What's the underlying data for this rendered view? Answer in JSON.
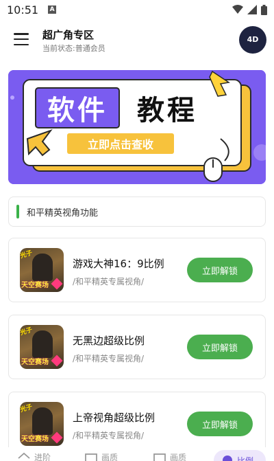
{
  "status": {
    "time": "10:51",
    "indicator": "A"
  },
  "header": {
    "title": "超广角专区",
    "subtitle": "当前状态:普通会员",
    "avatar_logo": "4D"
  },
  "banner": {
    "word1": "软件",
    "word2": "教程",
    "cta": "立即点击查收"
  },
  "section": {
    "title": "和平精英视角功能"
  },
  "items": [
    {
      "name": "游戏大神16：9比例",
      "subtitle": "/和平精英专属视角/",
      "button": "立即解锁",
      "image_tag": "光子",
      "image_label": "天空赛场"
    },
    {
      "name": "无黑边超级比例",
      "subtitle": "/和平精英专属视角/",
      "button": "立即解锁",
      "image_tag": "光子",
      "image_label": "天空赛场"
    },
    {
      "name": "上帝视角超级比例",
      "subtitle": "/和平精英专属视角/",
      "button": "立即解锁",
      "image_tag": "光子",
      "image_label": "天空赛场"
    }
  ],
  "nav": [
    {
      "label": "进阶",
      "icon": "home-icon"
    },
    {
      "label": "画质",
      "icon": "frame-icon"
    },
    {
      "label": "画质",
      "icon": "frame-icon"
    },
    {
      "label": "比例",
      "icon": "ratio-icon"
    }
  ],
  "colors": {
    "accent_green": "#4bae4f",
    "banner_purple": "#7a5cf0",
    "nav_active": "#6b4fd8"
  }
}
